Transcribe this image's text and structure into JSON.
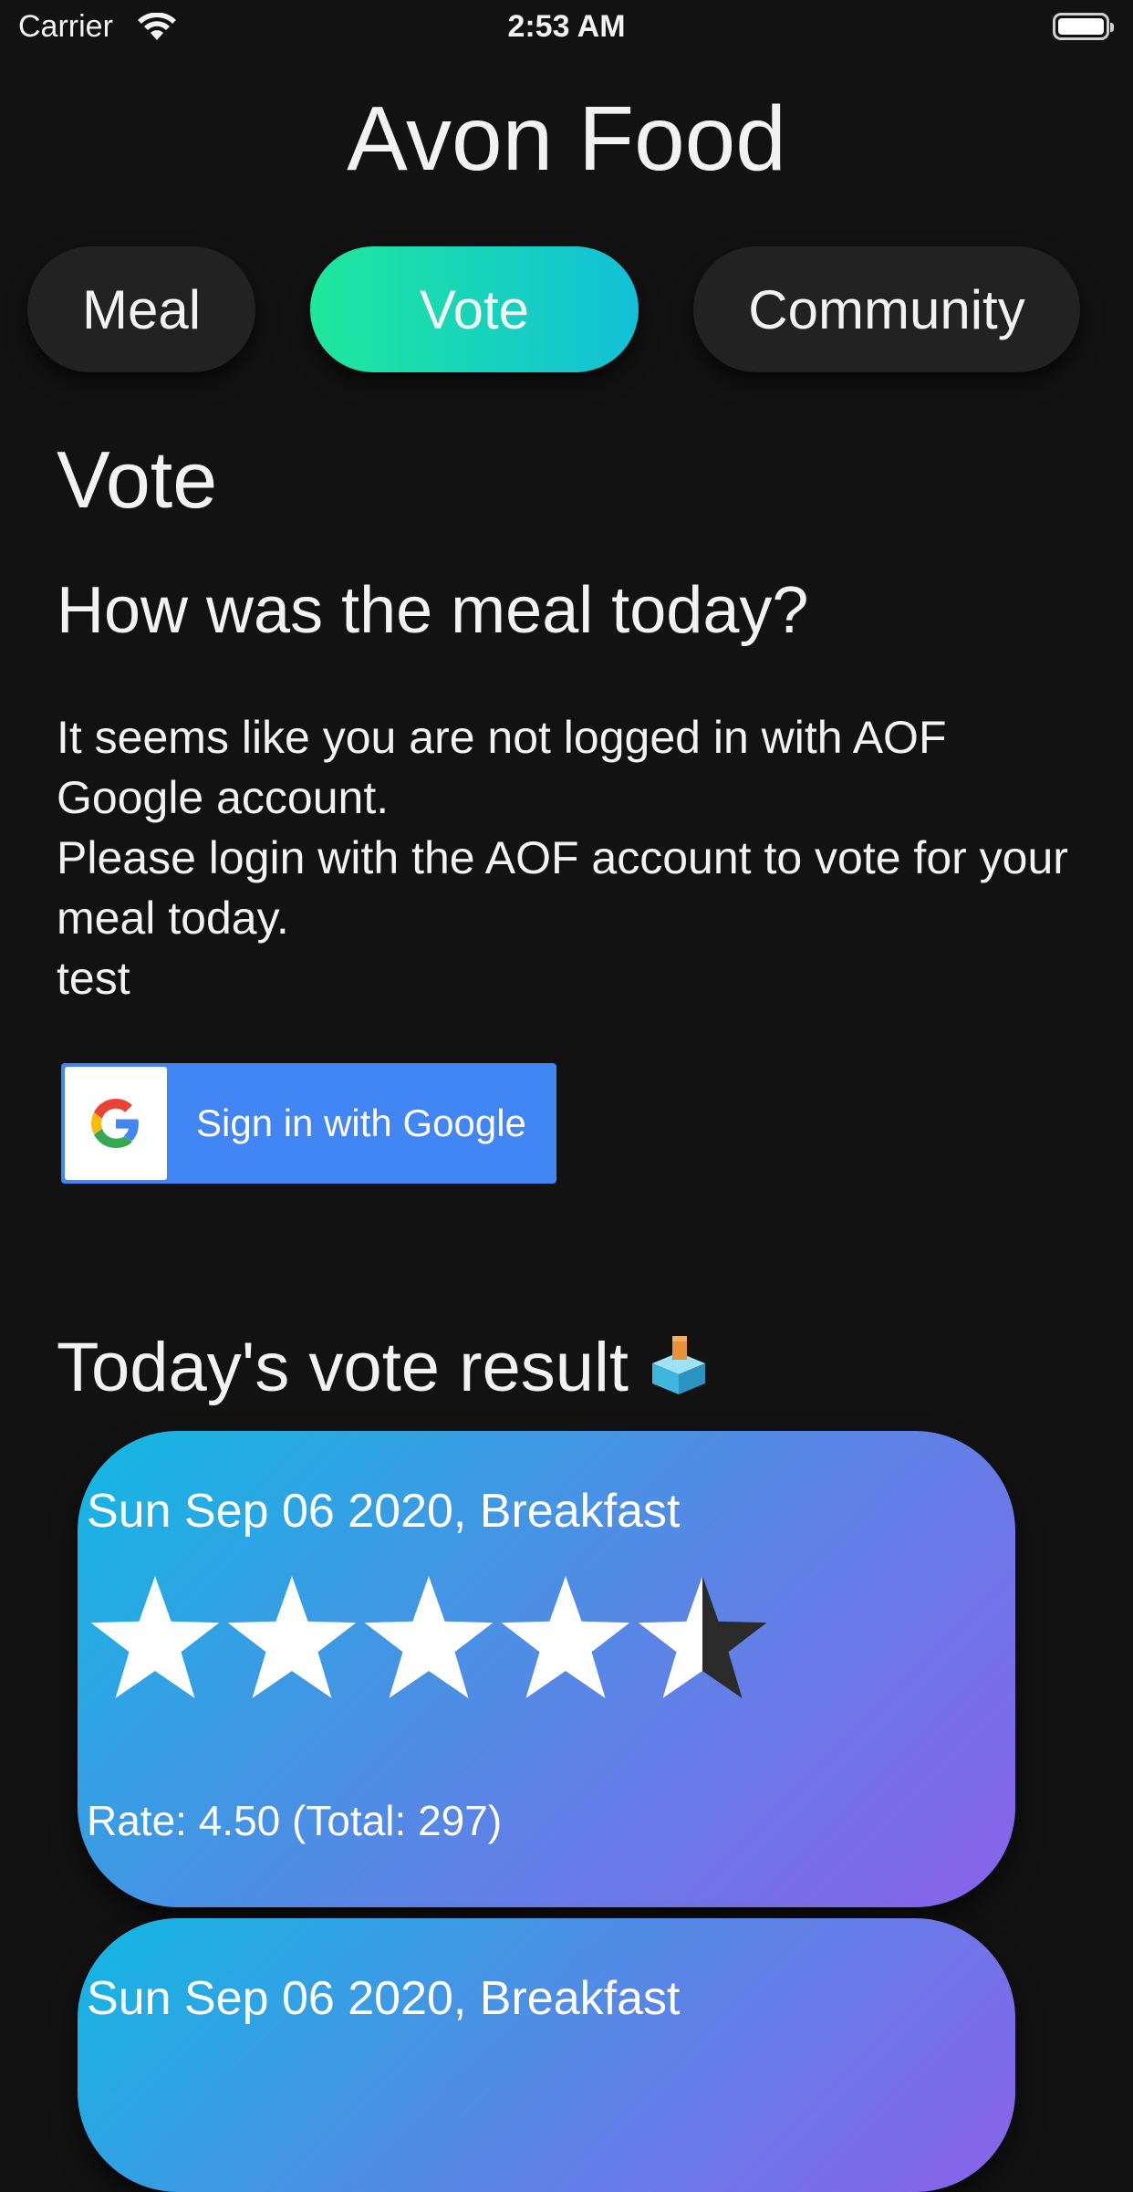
{
  "status_bar": {
    "carrier": "Carrier",
    "time": "2:53 AM"
  },
  "header": {
    "title": "Avon Food"
  },
  "tabs": [
    {
      "label": "Meal",
      "active": false
    },
    {
      "label": "Vote",
      "active": true
    },
    {
      "label": "Community",
      "active": false
    }
  ],
  "vote": {
    "title": "Vote",
    "question": "How was the meal today?",
    "login_message": "It seems like you are not logged in with AOF Google account.\nPlease login with the AOF account to vote for your meal today.\ntest",
    "google_button_label": "Sign in with Google"
  },
  "results": {
    "title": "Today's vote result",
    "title_icon": "ballot-box-icon",
    "cards": [
      {
        "date": "Sun Sep 06 2020, Breakfast",
        "rating": 4.5,
        "max_rating": 5,
        "rate_text": "Rate: 4.50 (Total: 297)"
      },
      {
        "date": "Sun Sep 06 2020, Breakfast"
      }
    ]
  },
  "colors": {
    "background": "#121212",
    "tab_inactive": "#222222",
    "tab_active_gradient": [
      "#1ee89b",
      "#12c0d8"
    ],
    "google_blue": "#4285f4",
    "card_gradient": [
      "#12b8e2",
      "#5a85e6",
      "#8a62ea"
    ],
    "star_filled": "#ffffff",
    "star_empty": "#2b2b2b"
  }
}
